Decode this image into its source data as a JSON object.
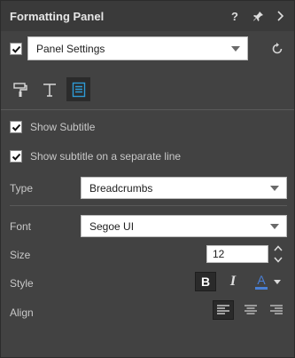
{
  "window": {
    "title": "Formatting Panel"
  },
  "titlebar_icons": [
    "help-icon",
    "pin-icon",
    "chevron-right-icon"
  ],
  "titlebar_labels": {
    "help": "?",
    "pin": "★",
    "next": "›"
  },
  "panel_settings": {
    "checked": true,
    "selected": "Panel Settings"
  },
  "tabs": [
    {
      "name": "paint-roller-icon",
      "active": false
    },
    {
      "name": "text-icon",
      "active": false
    },
    {
      "name": "subtitle-icon",
      "active": true
    }
  ],
  "options": {
    "show_subtitle": {
      "label": "Show Subtitle",
      "checked": true
    },
    "separate_line": {
      "label": "Show subtitle on a separate line",
      "checked": true
    }
  },
  "type": {
    "label": "Type",
    "value": "Breadcrumbs"
  },
  "font": {
    "label": "Font",
    "value": "Segoe UI"
  },
  "size": {
    "label": "Size",
    "value": "12"
  },
  "style": {
    "label": "Style",
    "bold": "B",
    "italic": "I",
    "color_letter": "A",
    "bold_active": true,
    "italic_active": false,
    "font_color": "#4a7fd4"
  },
  "align": {
    "label": "Align",
    "options": [
      "left",
      "center",
      "right"
    ],
    "selected": "left"
  },
  "colors": {
    "accent": "#2e9bd6",
    "background": "#424242",
    "titlebar": "#3a3a3a"
  }
}
